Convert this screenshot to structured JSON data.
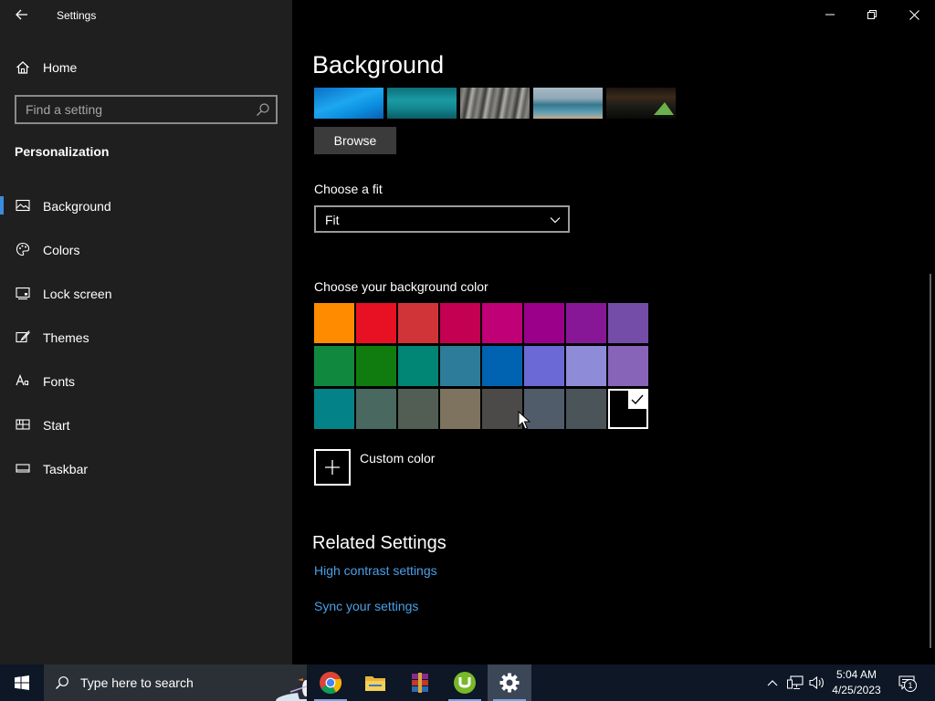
{
  "window": {
    "title": "Settings",
    "controls": [
      "minimize-icon",
      "restore-icon",
      "close-icon"
    ]
  },
  "sidebar": {
    "home_label": "Home",
    "search_placeholder": "Find a setting",
    "section_title": "Personalization",
    "items": [
      {
        "label": "Background",
        "icon": "picture-icon",
        "selected": true
      },
      {
        "label": "Colors",
        "icon": "palette-icon",
        "selected": false
      },
      {
        "label": "Lock screen",
        "icon": "lock-screen-icon",
        "selected": false
      },
      {
        "label": "Themes",
        "icon": "themes-brush-icon",
        "selected": false
      },
      {
        "label": "Fonts",
        "icon": "fonts-icon",
        "selected": false
      },
      {
        "label": "Start",
        "icon": "start-tiles-icon",
        "selected": false
      },
      {
        "label": "Taskbar",
        "icon": "taskbar-icon",
        "selected": false
      }
    ]
  },
  "main": {
    "title": "Background",
    "recent_images": [
      "blue-windows-wallpaper",
      "teal-lake-wallpaper",
      "rock-cliff-wallpaper",
      "beach-pier-wallpaper",
      "night-tent-wallpaper"
    ],
    "browse_label": "Browse",
    "fit_label": "Choose a fit",
    "fit_value": "Fit",
    "color_label": "Choose your background color",
    "colors": [
      [
        "#ff8c00",
        "#e81123",
        "#d13438",
        "#c30052",
        "#bf0077",
        "#9a0089",
        "#881798",
        "#744da9"
      ],
      [
        "#10893e",
        "#107c10",
        "#018574",
        "#2d7d9a",
        "#0063b1",
        "#6b69d6",
        "#8e8cd8",
        "#8764b8"
      ],
      [
        "#038387",
        "#486860",
        "#525e54",
        "#7e735f",
        "#4c4a48",
        "#515c6b",
        "#4a5459",
        "#000000"
      ]
    ],
    "selected_color": "#000000",
    "custom_color_label": "Custom color",
    "related_title": "Related Settings",
    "links": [
      "High contrast settings",
      "Sync your settings"
    ],
    "accent_link_color": "#4ba0e8"
  },
  "taskbar": {
    "search_text": "Type here to search",
    "apps": [
      {
        "name": "chrome-icon",
        "open": true,
        "active": false
      },
      {
        "name": "file-explorer-icon",
        "open": false,
        "active": false
      },
      {
        "name": "winrar-icon",
        "open": false,
        "active": false
      },
      {
        "name": "utorrent-icon",
        "open": true,
        "active": false
      },
      {
        "name": "settings-gear-icon",
        "open": true,
        "active": true
      }
    ],
    "tray_icons": [
      "chevron-up-icon",
      "network-icon",
      "volume-icon"
    ],
    "time": "5:04 AM",
    "date": "4/25/2023",
    "notification_count": "1"
  }
}
